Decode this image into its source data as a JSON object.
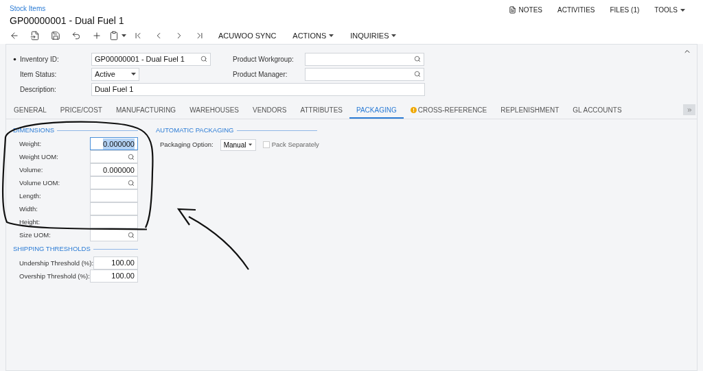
{
  "breadcrumb": "Stock Items",
  "title": "GP00000001 - Dual Fuel 1",
  "top_links": [
    {
      "label": "NOTES",
      "kind": "notes"
    },
    {
      "label": "ACTIVITIES",
      "kind": "plain"
    },
    {
      "label": "FILES (1)",
      "kind": "plain"
    },
    {
      "label": "TOOLS",
      "kind": "menu"
    }
  ],
  "toolbar": [
    {
      "kind": "back"
    },
    {
      "kind": "save-close"
    },
    {
      "kind": "save"
    },
    {
      "kind": "undo"
    },
    {
      "kind": "add"
    },
    {
      "kind": "copy"
    },
    {
      "kind": "first"
    },
    {
      "kind": "prev"
    },
    {
      "kind": "next"
    },
    {
      "kind": "last"
    },
    {
      "kind": "text",
      "label": "ACUWOO SYNC"
    },
    {
      "kind": "menu",
      "label": "ACTIONS"
    },
    {
      "kind": "menu",
      "label": "INQUIRIES"
    }
  ],
  "header_fields": [
    {
      "label": "Inventory ID:",
      "required": true,
      "kind": "lookup",
      "value": "GP00000001 - Dual Fuel 1"
    },
    {
      "label": "Item Status:",
      "required": false,
      "kind": "select",
      "value": "Active"
    },
    {
      "label": "Description:",
      "required": false,
      "kind": "wide",
      "value": "Dual Fuel 1"
    }
  ],
  "header_fields_right": [
    {
      "label": "Product Workgroup:",
      "kind": "lookup"
    },
    {
      "label": "Product Manager:",
      "kind": "lookup"
    }
  ],
  "tabs": [
    {
      "label": "GENERAL",
      "selected": false,
      "warning": false
    },
    {
      "label": "PRICE/COST",
      "selected": false,
      "warning": false
    },
    {
      "label": "MANUFACTURING",
      "selected": false,
      "warning": false
    },
    {
      "label": "WAREHOUSES",
      "selected": false,
      "warning": false
    },
    {
      "label": "VENDORS",
      "selected": false,
      "warning": false
    },
    {
      "label": "ATTRIBUTES",
      "selected": false,
      "warning": false
    },
    {
      "label": "PACKAGING",
      "selected": true,
      "warning": false
    },
    {
      "label": "CROSS-REFERENCE",
      "selected": false,
      "warning": true
    },
    {
      "label": "REPLENISHMENT",
      "selected": false,
      "warning": false
    },
    {
      "label": "GL ACCOUNTS",
      "selected": false,
      "warning": false
    }
  ],
  "sections": [
    {
      "title": "DIMENSIONS",
      "fields": [
        {
          "label": "Weight:",
          "kind": "number",
          "value": "0.000000",
          "selected": true
        },
        {
          "label": "Weight UOM:",
          "kind": "lookup",
          "selected": false
        },
        {
          "label": "Volume:",
          "kind": "number",
          "value": "0.000000",
          "selected": false
        },
        {
          "label": "Volume UOM:",
          "kind": "lookup",
          "selected": false
        },
        {
          "label": "Length:",
          "kind": "number",
          "selected": false
        },
        {
          "label": "Width:",
          "kind": "number",
          "selected": false
        },
        {
          "label": "Height:",
          "kind": "number",
          "selected": false
        },
        {
          "label": "Size UOM:",
          "kind": "lookup",
          "selected": false
        }
      ]
    },
    {
      "title": "SHIPPING THRESHOLDS",
      "fields": [
        {
          "label": "Undership Threshold (%):",
          "kind": "number",
          "value": "100.00",
          "selected": false
        },
        {
          "label": "Overship Threshold (%):",
          "kind": "number",
          "value": "100.00",
          "selected": false
        }
      ]
    }
  ],
  "auto_packaging": {
    "title": "AUTOMATIC PACKAGING",
    "option_label": "Packaging Option:",
    "option_value": "Manual",
    "checkbox": {
      "label": "Pack Separately",
      "checked": false
    }
  }
}
